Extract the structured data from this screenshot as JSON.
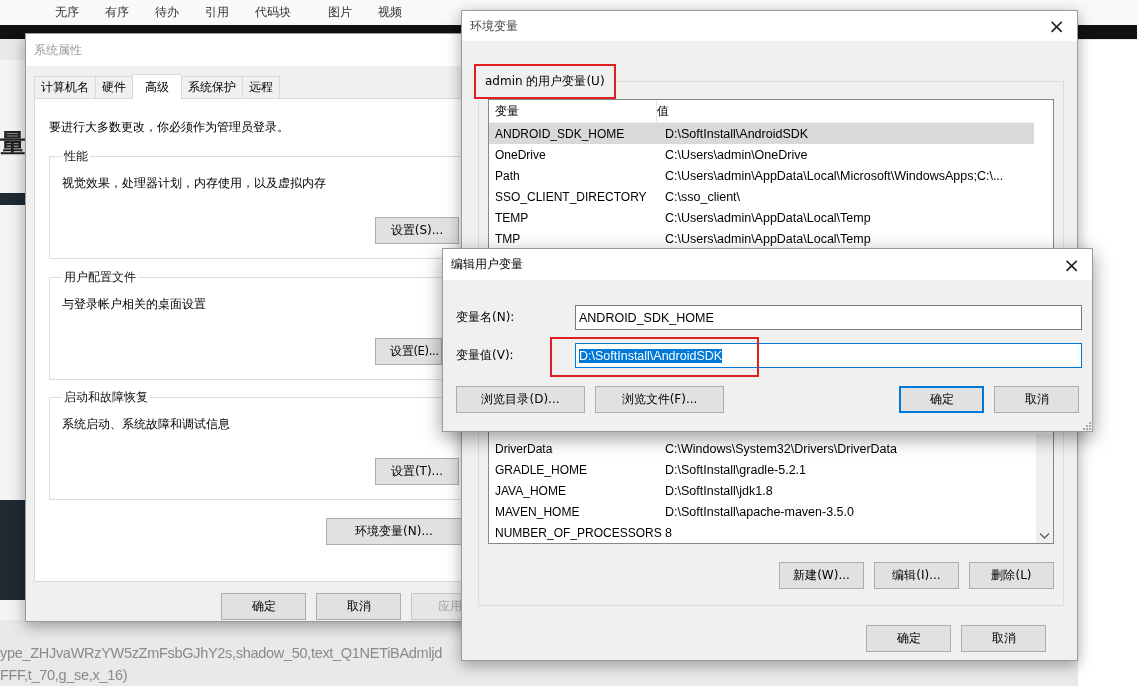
{
  "background_toolbar": {
    "items": [
      "无序",
      "有序",
      "待办",
      "引用",
      "代码块",
      "图片",
      "视频"
    ]
  },
  "background_page": {
    "heading_fragment": "量",
    "url_lines": [
      "ype_ZHJvaWRzYW5zZmFsbGJhY2s,shadow_50,text_Q1NETiBAdmljd",
      "FFF,t_70,g_se,x_16)"
    ]
  },
  "system_properties": {
    "title": "系统属性",
    "tabs": [
      {
        "label": "计算机名",
        "selected": false
      },
      {
        "label": "硬件",
        "selected": false
      },
      {
        "label": "高级",
        "selected": true
      },
      {
        "label": "系统保护",
        "selected": false
      },
      {
        "label": "远程",
        "selected": false
      }
    ],
    "admin_note": "要进行大多数更改，你必须作为管理员登录。",
    "groups": [
      {
        "title": "性能",
        "description": "视觉效果，处理器计划，内存使用，以及虚拟内存",
        "button": "设置(S)..."
      },
      {
        "title": "用户配置文件",
        "description": "与登录帐户相关的桌面设置",
        "button": "设置(E)..."
      },
      {
        "title": "启动和故障恢复",
        "description": "系统启动、系统故障和调试信息",
        "button": "设置(T)..."
      }
    ],
    "env_button": "环境变量(N)...",
    "buttons": [
      {
        "label": "确定",
        "disabled": false
      },
      {
        "label": "取消",
        "disabled": false
      },
      {
        "label": "应用",
        "disabled": true
      }
    ]
  },
  "environment_variables": {
    "title": "环境变量",
    "close": "×",
    "user_group": {
      "label": "admin 的用户变量(U)",
      "highlighted": true
    },
    "user_table": {
      "columns": [
        "变量",
        "值"
      ],
      "rows": [
        {
          "name": "ANDROID_SDK_HOME",
          "value": "D:\\SoftInstall\\AndroidSDK",
          "selected": true
        },
        {
          "name": "OneDrive",
          "value": "C:\\Users\\admin\\OneDrive",
          "selected": false
        },
        {
          "name": "Path",
          "value": "C:\\Users\\admin\\AppData\\Local\\Microsoft\\WindowsApps;C:\\...",
          "selected": false
        },
        {
          "name": "SSO_CLIENT_DIRECTORY",
          "value": "C:\\sso_client\\",
          "selected": false
        },
        {
          "name": "TEMP",
          "value": "C:\\Users\\admin\\AppData\\Local\\Temp",
          "selected": false
        },
        {
          "name": "TMP",
          "value": "C:\\Users\\admin\\AppData\\Local\\Temp",
          "selected": false
        }
      ]
    },
    "system_table": {
      "rows": [
        {
          "name": "DriverData",
          "value": "C:\\Windows\\System32\\Drivers\\DriverData"
        },
        {
          "name": "GRADLE_HOME",
          "value": "D:\\SoftInstall\\gradle-5.2.1"
        },
        {
          "name": "JAVA_HOME",
          "value": "D:\\SoftInstall\\jdk1.8"
        },
        {
          "name": "MAVEN_HOME",
          "value": "D:\\SoftInstall\\apache-maven-3.5.0"
        },
        {
          "name": "NUMBER_OF_PROCESSORS",
          "value": "8"
        }
      ]
    },
    "system_buttons": [
      "新建(W)...",
      "编辑(I)...",
      "删除(L)"
    ],
    "buttons": [
      "确定",
      "取消"
    ]
  },
  "edit_dialog": {
    "title": "编辑用户变量",
    "close": "×",
    "fields": [
      {
        "label": "变量名(N):",
        "value": "ANDROID_SDK_HOME",
        "focused": false,
        "text_selected": false,
        "highlighted": false
      },
      {
        "label": "变量值(V):",
        "value": "D:\\SoftInstall\\AndroidSDK",
        "focused": true,
        "text_selected": true,
        "highlighted": true
      }
    ],
    "buttons": [
      {
        "label": "浏览目录(D)...",
        "default": false
      },
      {
        "label": "浏览文件(F)...",
        "default": false
      },
      {
        "label": "确定",
        "default": true
      },
      {
        "label": "取消",
        "default": false
      }
    ]
  }
}
